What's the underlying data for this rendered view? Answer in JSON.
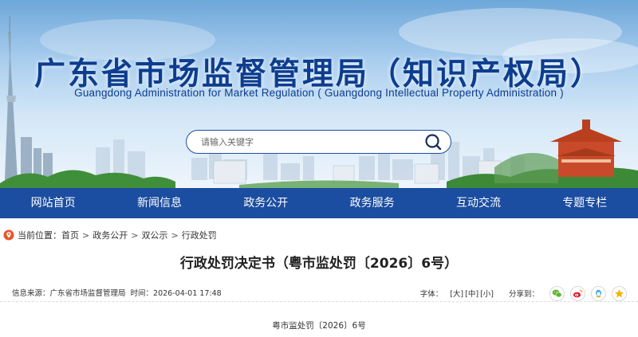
{
  "header": {
    "title_cn": "广东省市场监督管理局（知识产权局）",
    "title_en": "Guangdong Administration for Market Regulation ( Guangdong Intellectual Property Administration )",
    "search": {
      "placeholder": "请输入关键字"
    }
  },
  "nav": {
    "items": [
      {
        "label": "网站首页"
      },
      {
        "label": "新闻信息"
      },
      {
        "label": "政务公开"
      },
      {
        "label": "政务服务"
      },
      {
        "label": "互动交流"
      },
      {
        "label": "专题专栏"
      }
    ]
  },
  "breadcrumb": {
    "prefix": "当前位置：",
    "items": [
      "首页",
      "政务公开",
      "双公示",
      "行政处罚"
    ],
    "separator": ">"
  },
  "article": {
    "title": "行政处罚决定书（粤市监处罚〔2026〕6号）",
    "meta": {
      "source_label": "信息来源：",
      "source": "广东省市场监督管理局",
      "time_label": "时间：",
      "time": "2026-04-01 17:48",
      "font_label": "字体：",
      "font_large": "[大]",
      "font_medium": "[中]",
      "font_small": "[小]",
      "share_label": "分享到："
    },
    "doc_number": "粤市监处罚〔2026〕6号"
  },
  "colors": {
    "nav_bg": "#1b4da0",
    "title_blue": "#0d3d8f",
    "wechat": "#5cb531",
    "weibo": "#e6162d",
    "qq": "#3aa0e0",
    "qzone": "#f2b400"
  },
  "icons": {
    "search": "magnifier-icon",
    "location": "location-pin-icon",
    "share": [
      "wechat-icon",
      "weibo-icon",
      "qq-icon",
      "qzone-icon"
    ]
  }
}
